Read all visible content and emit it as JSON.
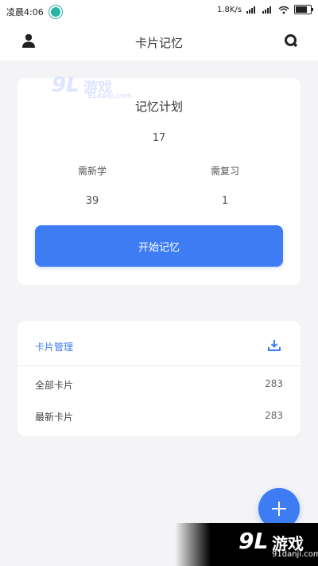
{
  "status_bar": {
    "time": "凌晨4:06",
    "speed": "1.8K/s",
    "battery_percent": 75
  },
  "appbar": {
    "title": "卡片记忆",
    "left_icon": "user-icon",
    "right_icon": "search-icon"
  },
  "plan": {
    "title": "记忆计划",
    "total": "17",
    "new_label": "需新学",
    "new_value": "39",
    "review_label": "需复习",
    "review_value": "1",
    "start_button": "开始记忆"
  },
  "manage": {
    "title": "卡片管理",
    "icon": "download-icon",
    "rows": [
      {
        "label": "全部卡片",
        "count": "283"
      },
      {
        "label": "最新卡片",
        "count": "283"
      }
    ]
  },
  "fab": {
    "icon": "plus-icon"
  },
  "watermarks": {
    "top": {
      "logo": "9L",
      "text": "游戏",
      "url": "91danji.com"
    },
    "bottom": {
      "logo": "9L",
      "text": "游戏",
      "url": "91danji.com"
    }
  },
  "colors": {
    "accent": "#3d7cf3",
    "background": "#f4f4f6",
    "card": "#ffffff"
  }
}
